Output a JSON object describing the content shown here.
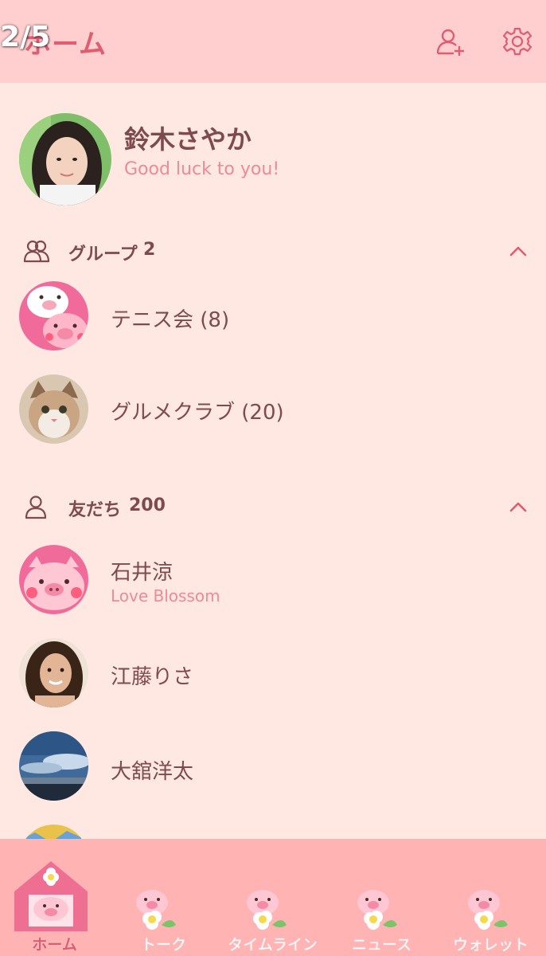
{
  "page_counter": "2/5",
  "header": {
    "title": "ホーム",
    "add_friend_icon": "person-add-icon",
    "settings_icon": "gear-icon"
  },
  "profile": {
    "name": "鈴木さやか",
    "status": "Good luck to you!"
  },
  "groups": {
    "label": "グループ",
    "count": "2",
    "items": [
      {
        "name": "テニス会 (8)"
      },
      {
        "name": "グルメクラブ (20)"
      }
    ]
  },
  "friends": {
    "label": "友だち",
    "count": "200",
    "items": [
      {
        "name": "石井涼",
        "status": "Love Blossom"
      },
      {
        "name": "江藤りさ"
      },
      {
        "name": "大舘洋太"
      }
    ]
  },
  "tabs": [
    {
      "label": "ホーム",
      "active": true
    },
    {
      "label": "トーク"
    },
    {
      "label": "タイムライン"
    },
    {
      "label": "ニュース"
    },
    {
      "label": "ウォレット"
    }
  ],
  "colors": {
    "header_bg": "#ffcfd0",
    "body_bg": "#ffe8e1",
    "tabbar_bg": "#ffb3b3",
    "accent": "#e05c71",
    "status_text": "#ec8b97"
  }
}
